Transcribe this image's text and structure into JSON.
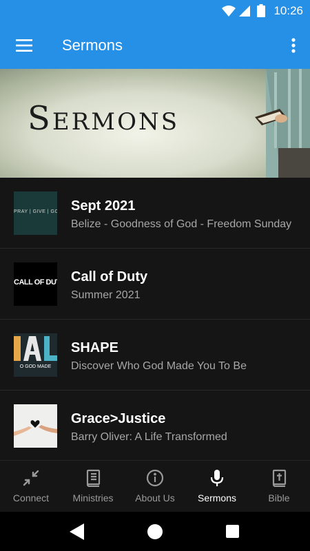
{
  "status_bar": {
    "time": "10:26"
  },
  "app_bar": {
    "title": "Sermons"
  },
  "hero": {
    "text": "Sermons"
  },
  "sermons": [
    {
      "title": "Sept 2021",
      "subtitle": "Belize - Goodness of God  - Freedom Sunday",
      "thumb_text": "PRAY | GIVE | GO"
    },
    {
      "title": "Call of Duty",
      "subtitle": "Summer 2021",
      "thumb_text": "CALL OF DUTY"
    },
    {
      "title": "SHAPE",
      "subtitle": "Discover Who God Made You To Be",
      "thumb_text": "O GOD MADE"
    },
    {
      "title": "Grace>Justice",
      "subtitle": "Barry Oliver: A Life Transformed",
      "thumb_text": ""
    }
  ],
  "bottom_nav": [
    {
      "label": "Connect",
      "icon": "connect-icon"
    },
    {
      "label": "Ministries",
      "icon": "book-icon"
    },
    {
      "label": "About Us",
      "icon": "info-icon"
    },
    {
      "label": "Sermons",
      "icon": "microphone-icon",
      "active": true
    },
    {
      "label": "Bible",
      "icon": "bible-icon"
    }
  ],
  "colors": {
    "primary": "#2590e6",
    "background": "#151515",
    "subtitle": "#a7a7a7",
    "nav_inactive": "#9a9a9a"
  }
}
